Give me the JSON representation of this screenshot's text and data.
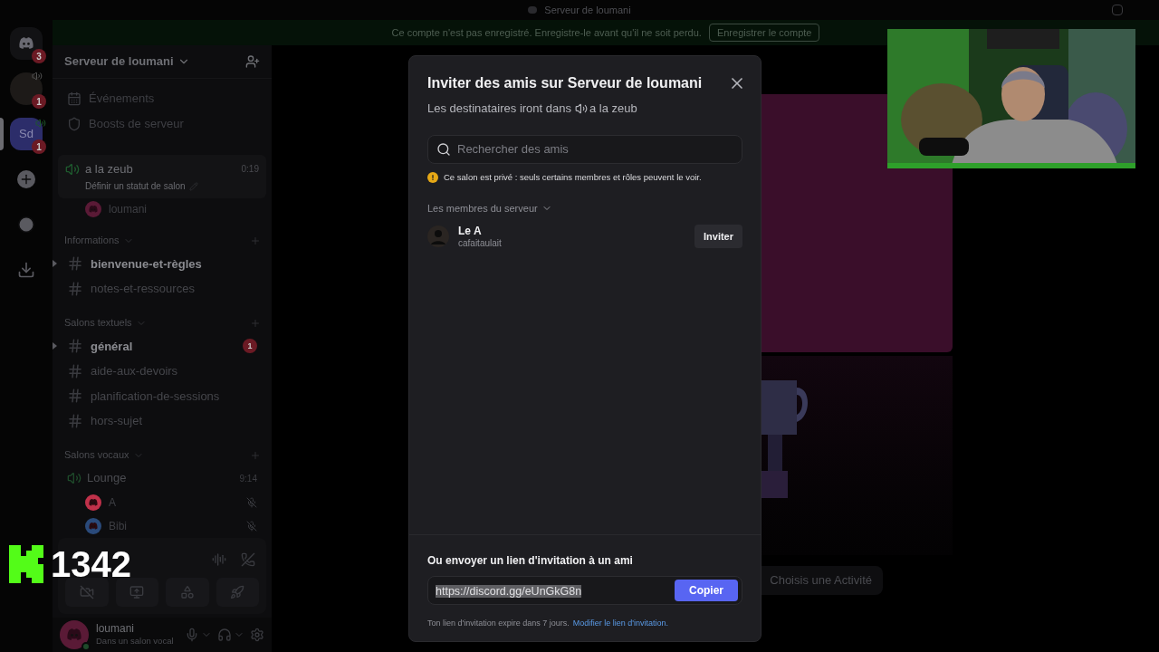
{
  "window": {
    "title": "Serveur de loumani"
  },
  "banner": {
    "text": "Ce compte n'est pas enregistré. Enregistre-le avant qu'il ne soit perdu.",
    "button": "Enregistrer le compte"
  },
  "server_rail": [
    {
      "kind": "home",
      "badge": "3",
      "selected": false
    },
    {
      "kind": "avatar",
      "badge": "1",
      "selected": false
    },
    {
      "kind": "server",
      "label": "Sd",
      "badge": "1",
      "selected": true
    },
    {
      "kind": "add",
      "selected": false
    },
    {
      "kind": "explore",
      "selected": false
    },
    {
      "kind": "download",
      "selected": false
    }
  ],
  "sidebar": {
    "server_name": "Serveur de loumani",
    "links": [
      {
        "kind": "events",
        "label": "Événements"
      },
      {
        "kind": "boosts",
        "label": "Boosts de serveur"
      }
    ],
    "active_voice": {
      "name": "a la zeub",
      "time": "0:19",
      "status": "Définir un statut de salon",
      "members": [
        {
          "name": "loumani",
          "muted": false
        }
      ]
    },
    "categories": [
      {
        "name": "Informations",
        "channels": [
          {
            "kind": "text",
            "name": "bienvenue-et-règles",
            "unread": true
          },
          {
            "kind": "text",
            "name": "notes-et-ressources",
            "unread": false
          }
        ]
      },
      {
        "name": "Salons textuels",
        "channels": [
          {
            "kind": "text",
            "name": "général",
            "unread": true,
            "badge": "1"
          },
          {
            "kind": "text",
            "name": "aide-aux-devoirs",
            "unread": false
          },
          {
            "kind": "text",
            "name": "planification-de-sessions",
            "unread": false
          },
          {
            "kind": "text",
            "name": "hors-sujet",
            "unread": false
          }
        ]
      },
      {
        "name": "Salons vocaux",
        "channels": [
          {
            "kind": "voice",
            "name": "Lounge",
            "unread": false,
            "time": "9:14",
            "members": [
              {
                "name": "A",
                "muted": true,
                "color": "#c0314a"
              },
              {
                "name": "Bibi",
                "muted": true,
                "color": "#2a4a7a"
              }
            ]
          }
        ]
      }
    ],
    "user": {
      "name": "loumani",
      "status": "Dans un salon vocal"
    }
  },
  "main": {
    "activity_button": "Choisis une Activité"
  },
  "modal": {
    "title": "Inviter des amis sur Serveur de loumani",
    "subtitle": "Les destinataires iront dans",
    "channel": "a la zeub",
    "search": {
      "placeholder": "Rechercher des amis"
    },
    "notice": "Ce salon est privé : seuls certains membres et rôles peuvent le voir.",
    "section": "Les membres du serveur",
    "members": [
      {
        "name": "Le A",
        "username": "cafaitaulait",
        "action": "Inviter"
      }
    ],
    "link_title": "Ou envoyer un lien d'invitation à un ami",
    "link": {
      "value": "https://discord.gg/eUnGkG8n",
      "selected": true
    },
    "copy_button": "Copier",
    "expiry": "Ton lien d'invitation expire dans 7 jours.",
    "edit_link": "Modifier le lien d'invitation."
  },
  "stream_overlay": {
    "count": "1342"
  }
}
